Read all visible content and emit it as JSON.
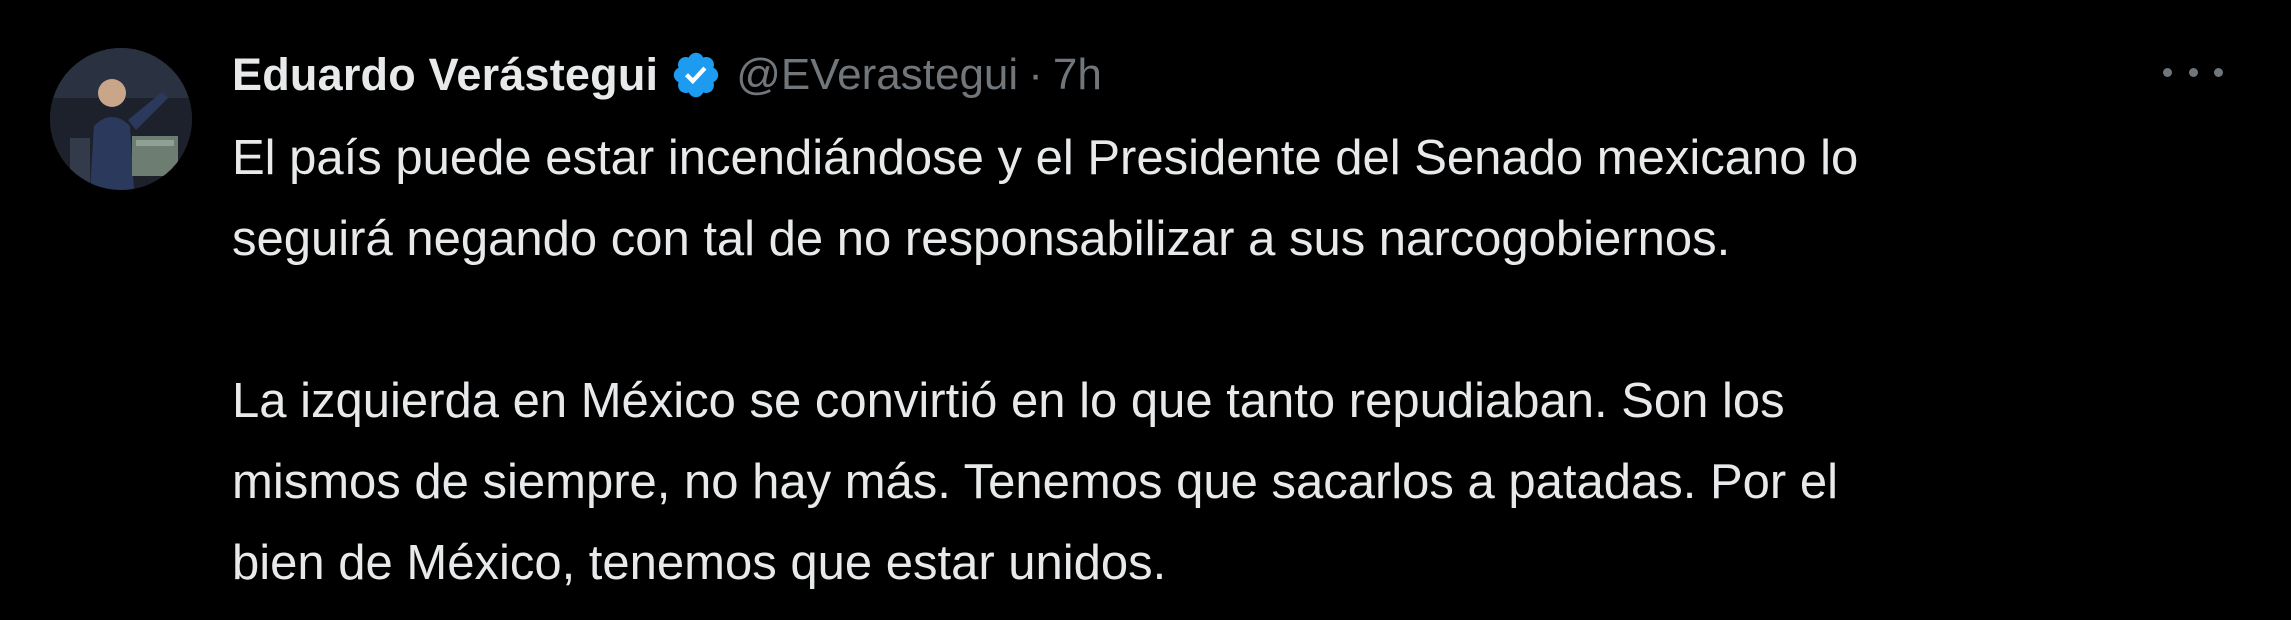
{
  "tweet": {
    "author": {
      "display_name": "Eduardo Verástegui",
      "handle": "@EVerastegui",
      "verified_icon": "verified-badge-icon",
      "avatar": "profile-photo"
    },
    "separator": "·",
    "time": "7h",
    "more_icon": "more-options-icon",
    "paragraphs": [
      "El país puede estar incendiándose y el Presidente del Senado mexicano lo\nseguirá negando con tal de no responsabilizar a sus narcogobiernos.",
      "La izquierda en México se convirtió en lo que tanto repudiaban. Son los\nmismos de siempre, no hay más. Tenemos que sacarlos a patadas. Por el\nbien de México, tenemos que estar unidos."
    ]
  },
  "colors": {
    "background": "#000000",
    "text": "#e7e9ea",
    "muted": "#71767b",
    "verified": "#1d9bf0"
  }
}
